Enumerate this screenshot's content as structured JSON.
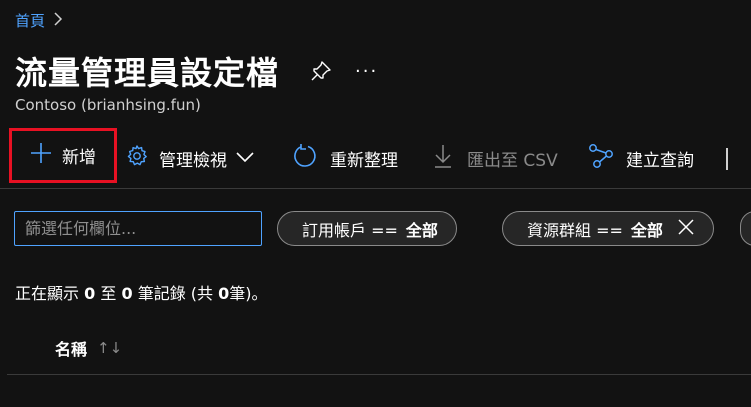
{
  "breadcrumb": {
    "home": "首頁"
  },
  "header": {
    "title": "流量管理員設定檔",
    "subtitle": "Contoso (brianhsing.fun)"
  },
  "toolbar": {
    "add": "新增",
    "manage_view": "管理檢視",
    "refresh": "重新整理",
    "export_csv": "匯出至 CSV",
    "create_query": "建立查詢"
  },
  "filters": {
    "placeholder": "篩選任何欄位...",
    "subscription": {
      "label": "訂用帳戶 ==",
      "value": "全部"
    },
    "resource_group": {
      "label": "資源群組 ==",
      "value": "全部"
    }
  },
  "records": {
    "prefix": "正在顯示",
    "from": "0",
    "to_word": "至",
    "to": "0",
    "suffix": "筆記錄 (共",
    "total": "0",
    "end": "筆)。"
  },
  "table": {
    "columns": [
      "名稱"
    ]
  },
  "colors": {
    "accent": "#4fa3ff",
    "highlight": "#e81123",
    "background": "#121212"
  },
  "icons": [
    "chevron-right-icon",
    "pin-icon",
    "more-icon",
    "plus-icon",
    "gear-icon",
    "chevron-down-icon",
    "refresh-icon",
    "download-icon",
    "share-icon",
    "close-icon",
    "sort-icon"
  ]
}
